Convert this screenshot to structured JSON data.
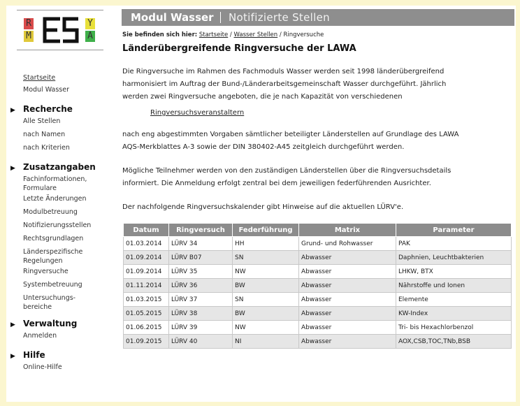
{
  "logo": {
    "letters": [
      "R",
      "Y",
      "M",
      "A"
    ],
    "colors": {
      "r": "#d94b4b",
      "y": "#e8e03a",
      "m": "#e0c93a",
      "a": "#3fb04a"
    }
  },
  "sidebar": {
    "top_links": [
      {
        "label": "Startseite",
        "underline": true
      },
      {
        "label": "Modul Wasser",
        "underline": false
      }
    ],
    "sections": [
      {
        "title": "Recherche",
        "items": [
          "Alle Stellen",
          "nach Namen",
          "nach Kriterien"
        ]
      },
      {
        "title": "Zusatzangaben",
        "items": [
          "Fachinformationen,\nFormulare",
          "Letzte Änderungen",
          "Modulbetreuung",
          "Notifizierungsstellen",
          "Rechtsgrundlagen",
          "Länderspezifische\nRegelungen",
          "Ringversuche",
          "Systembetreuung",
          "Untersuchungs-\nbereiche"
        ]
      },
      {
        "title": "Verwaltung",
        "items": [
          "Anmelden"
        ]
      },
      {
        "title": "Hilfe",
        "items": [
          "Online-Hilfe"
        ]
      }
    ]
  },
  "header": {
    "title": "Modul Wasser",
    "subtitle": "Notifizierte Stellen"
  },
  "breadcrumb": {
    "prefix": "Sie befinden sich hier:",
    "items": [
      "Startseite",
      "Wasser Stellen",
      "Ringversuche"
    ],
    "sep": " / "
  },
  "page_title": "Länderübergreifende Ringversuche der LAWA",
  "paragraphs": {
    "p1": [
      "Die Ringversuche im Rahmen des Fachmoduls Wasser werden seit 1998 länderübergreifend",
      "harmonisiert im Auftrag der Bund-/Länderarbeitsgemeinschaft Wasser durchgeführt. Jährlich",
      "werden zwei Ringversuche angeboten, die je nach Kapazität von verschiedenen"
    ],
    "link": "Ringversuchsveranstaltern",
    "p2": [
      "nach eng abgestimmten Vorgaben sämtlicher beteiligter Länderstellen auf Grundlage des LAWA",
      "AQS-Merkblattes A-3 sowie der DIN 380402-A45 zeitgleich durchgeführt werden."
    ],
    "p3": [
      "Mögliche Teilnehmer werden von den zuständigen Länderstellen über die Ringversuchsdetails",
      "informiert. Die Anmeldung erfolgt zentral bei dem jeweiligen federführenden Ausrichter."
    ],
    "p4": [
      "Der nachfolgende Ringversuchskalender gibt Hinweise auf die aktuellen LÜRV'e."
    ]
  },
  "table": {
    "headers": [
      "Datum",
      "Ringversuch",
      "Federführung",
      "Matrix",
      "Parameter"
    ],
    "rows": [
      [
        "01.03.2014",
        "LÜRV 34",
        "HH",
        "Grund- und Rohwasser",
        "PAK"
      ],
      [
        "01.09.2014",
        "LÜRV B07",
        "SN",
        "Abwasser",
        "Daphnien, Leuchtbakterien"
      ],
      [
        "01.09.2014",
        "LÜRV 35",
        "NW",
        "Abwasser",
        "LHKW, BTX"
      ],
      [
        "01.11.2014",
        "LÜRV 36",
        "BW",
        "Abwasser",
        "Nährstoffe und Ionen"
      ],
      [
        "01.03.2015",
        "LÜRV 37",
        "SN",
        "Abwasser",
        "Elemente"
      ],
      [
        "01.05.2015",
        "LÜRV 38",
        "BW",
        "Abwasser",
        "KW-Index"
      ],
      [
        "01.06.2015",
        "LÜRV 39",
        "NW",
        "Abwasser",
        "Tri- bis Hexachlorbenzol"
      ],
      [
        "01.09.2015",
        "LÜRV 40",
        "NI",
        "Abwasser",
        "AOX,CSB,TOC,TNb,BSB"
      ]
    ]
  }
}
